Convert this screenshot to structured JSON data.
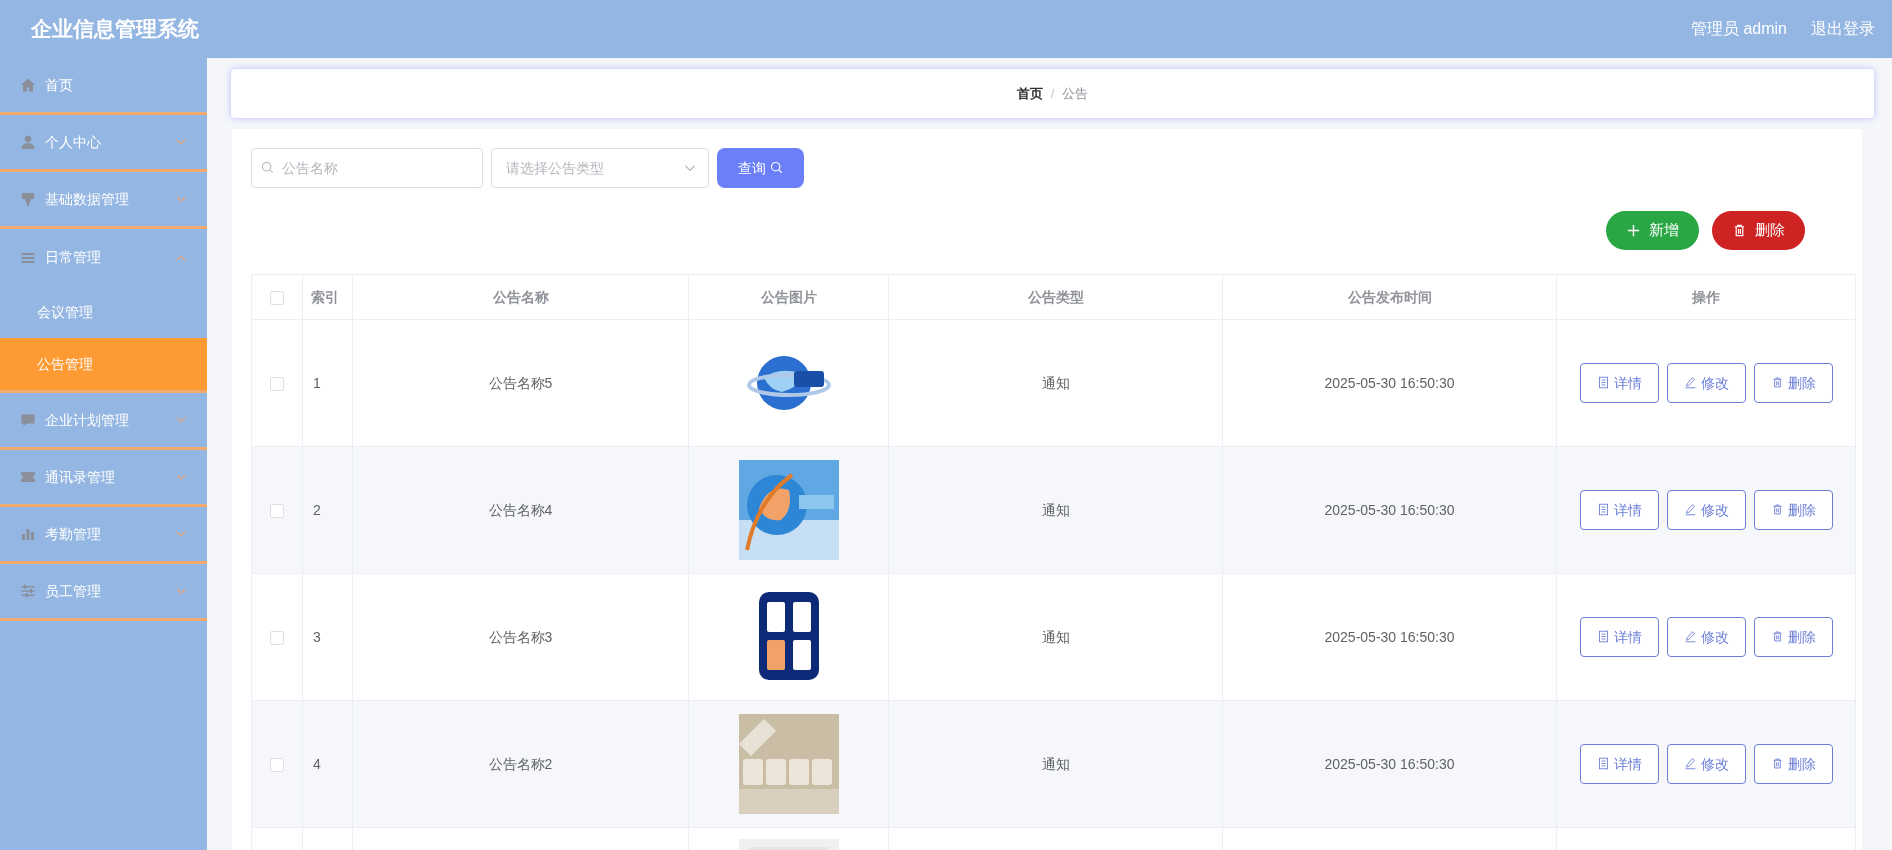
{
  "header": {
    "title": "企业信息管理系统",
    "user": "管理员 admin",
    "logout": "退出登录"
  },
  "sidebar": {
    "items": [
      {
        "label": "首页",
        "selected": false
      },
      {
        "label": "个人中心",
        "selected": false,
        "expanded": false
      },
      {
        "label": "基础数据管理",
        "selected": false,
        "expanded": false
      },
      {
        "label": "日常管理",
        "selected": false,
        "expanded": true,
        "children": [
          {
            "label": "会议管理",
            "selected": false
          },
          {
            "label": "公告管理",
            "selected": true
          }
        ]
      },
      {
        "label": "企业计划管理",
        "selected": false,
        "expanded": false
      },
      {
        "label": "通讯录管理",
        "selected": false,
        "expanded": false
      },
      {
        "label": "考勤管理",
        "selected": false,
        "expanded": false
      },
      {
        "label": "员工管理",
        "selected": false,
        "expanded": false
      }
    ]
  },
  "breadcrumb": {
    "items": [
      "首页",
      "公告"
    ],
    "separator": "/"
  },
  "search": {
    "name_placeholder": "公告名称",
    "type_placeholder": "请选择公告类型",
    "button": "查询"
  },
  "toolbar": [
    {
      "label": "新增",
      "kind": "add"
    },
    {
      "label": "删除",
      "kind": "delete"
    }
  ],
  "table": {
    "header_checked": false,
    "columns": [
      "索引",
      "公告名称",
      "公告图片",
      "公告类型",
      "公告发布时间",
      "操作"
    ],
    "rows": [
      {
        "kind": "full",
        "checked": false,
        "index": "1",
        "name": "公告名称5",
        "type": "通知",
        "time": "2025-05-30 16:50:30",
        "actions": [
          {
            "label": "详情",
            "kind": "detail"
          },
          {
            "label": "修改",
            "kind": "edit"
          },
          {
            "label": "删除",
            "kind": "delete"
          }
        ]
      },
      {
        "kind": "full",
        "checked": false,
        "index": "2",
        "name": "公告名称4",
        "type": "通知",
        "time": "2025-05-30 16:50:30",
        "actions": [
          {
            "label": "详情",
            "kind": "detail"
          },
          {
            "label": "修改",
            "kind": "edit"
          },
          {
            "label": "删除",
            "kind": "delete"
          }
        ]
      },
      {
        "kind": "full",
        "checked": false,
        "index": "3",
        "name": "公告名称3",
        "type": "通知",
        "time": "2025-05-30 16:50:30",
        "actions": [
          {
            "label": "详情",
            "kind": "detail"
          },
          {
            "label": "修改",
            "kind": "edit"
          },
          {
            "label": "删除",
            "kind": "delete"
          }
        ]
      },
      {
        "kind": "full",
        "checked": false,
        "index": "4",
        "name": "公告名称2",
        "type": "通知",
        "time": "2025-05-30 16:50:30",
        "actions": [
          {
            "label": "详情",
            "kind": "detail"
          },
          {
            "label": "修改",
            "kind": "edit"
          },
          {
            "label": "删除",
            "kind": "delete"
          }
        ]
      },
      {
        "kind": "partial"
      }
    ]
  }
}
